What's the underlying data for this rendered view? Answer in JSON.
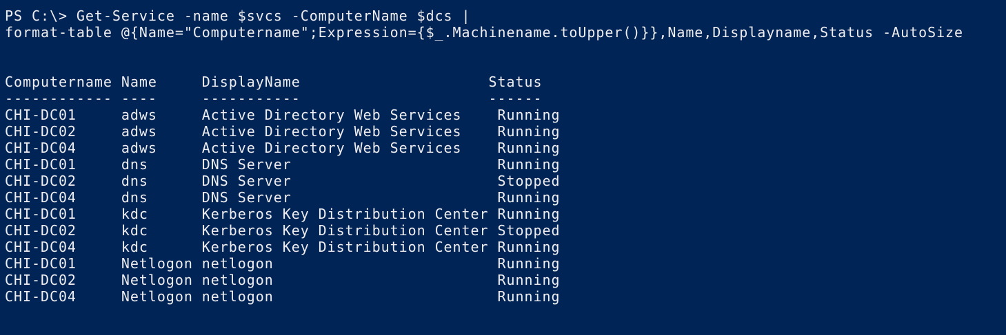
{
  "console": {
    "colors": {
      "background": "#012456",
      "foreground": "#EEEDF0"
    },
    "command_line_1": "PS C:\\> Get-Service -name $svcs -ComputerName $dcs |",
    "command_line_2": "format-table @{Name=\"Computername\";Expression={$_.Machinename.toUpper()}},Name,Displayname,Status -AutoSize",
    "table": {
      "header": "Computername Name     DisplayName                     Status",
      "separator": "------------ ----     -----------                     ------",
      "rows": [
        "CHI-DC01     adws     Active Directory Web Services    Running",
        "CHI-DC02     adws     Active Directory Web Services    Running",
        "CHI-DC04     adws     Active Directory Web Services    Running",
        "CHI-DC01     dns      DNS Server                       Running",
        "CHI-DC02     dns      DNS Server                       Stopped",
        "CHI-DC04     dns      DNS Server                       Running",
        "CHI-DC01     kdc      Kerberos Key Distribution Center Running",
        "CHI-DC02     kdc      Kerberos Key Distribution Center Stopped",
        "CHI-DC04     kdc      Kerberos Key Distribution Center Running",
        "CHI-DC01     Netlogon netlogon                         Running",
        "CHI-DC02     Netlogon netlogon                         Running",
        "CHI-DC04     Netlogon netlogon                         Running"
      ]
    }
  }
}
